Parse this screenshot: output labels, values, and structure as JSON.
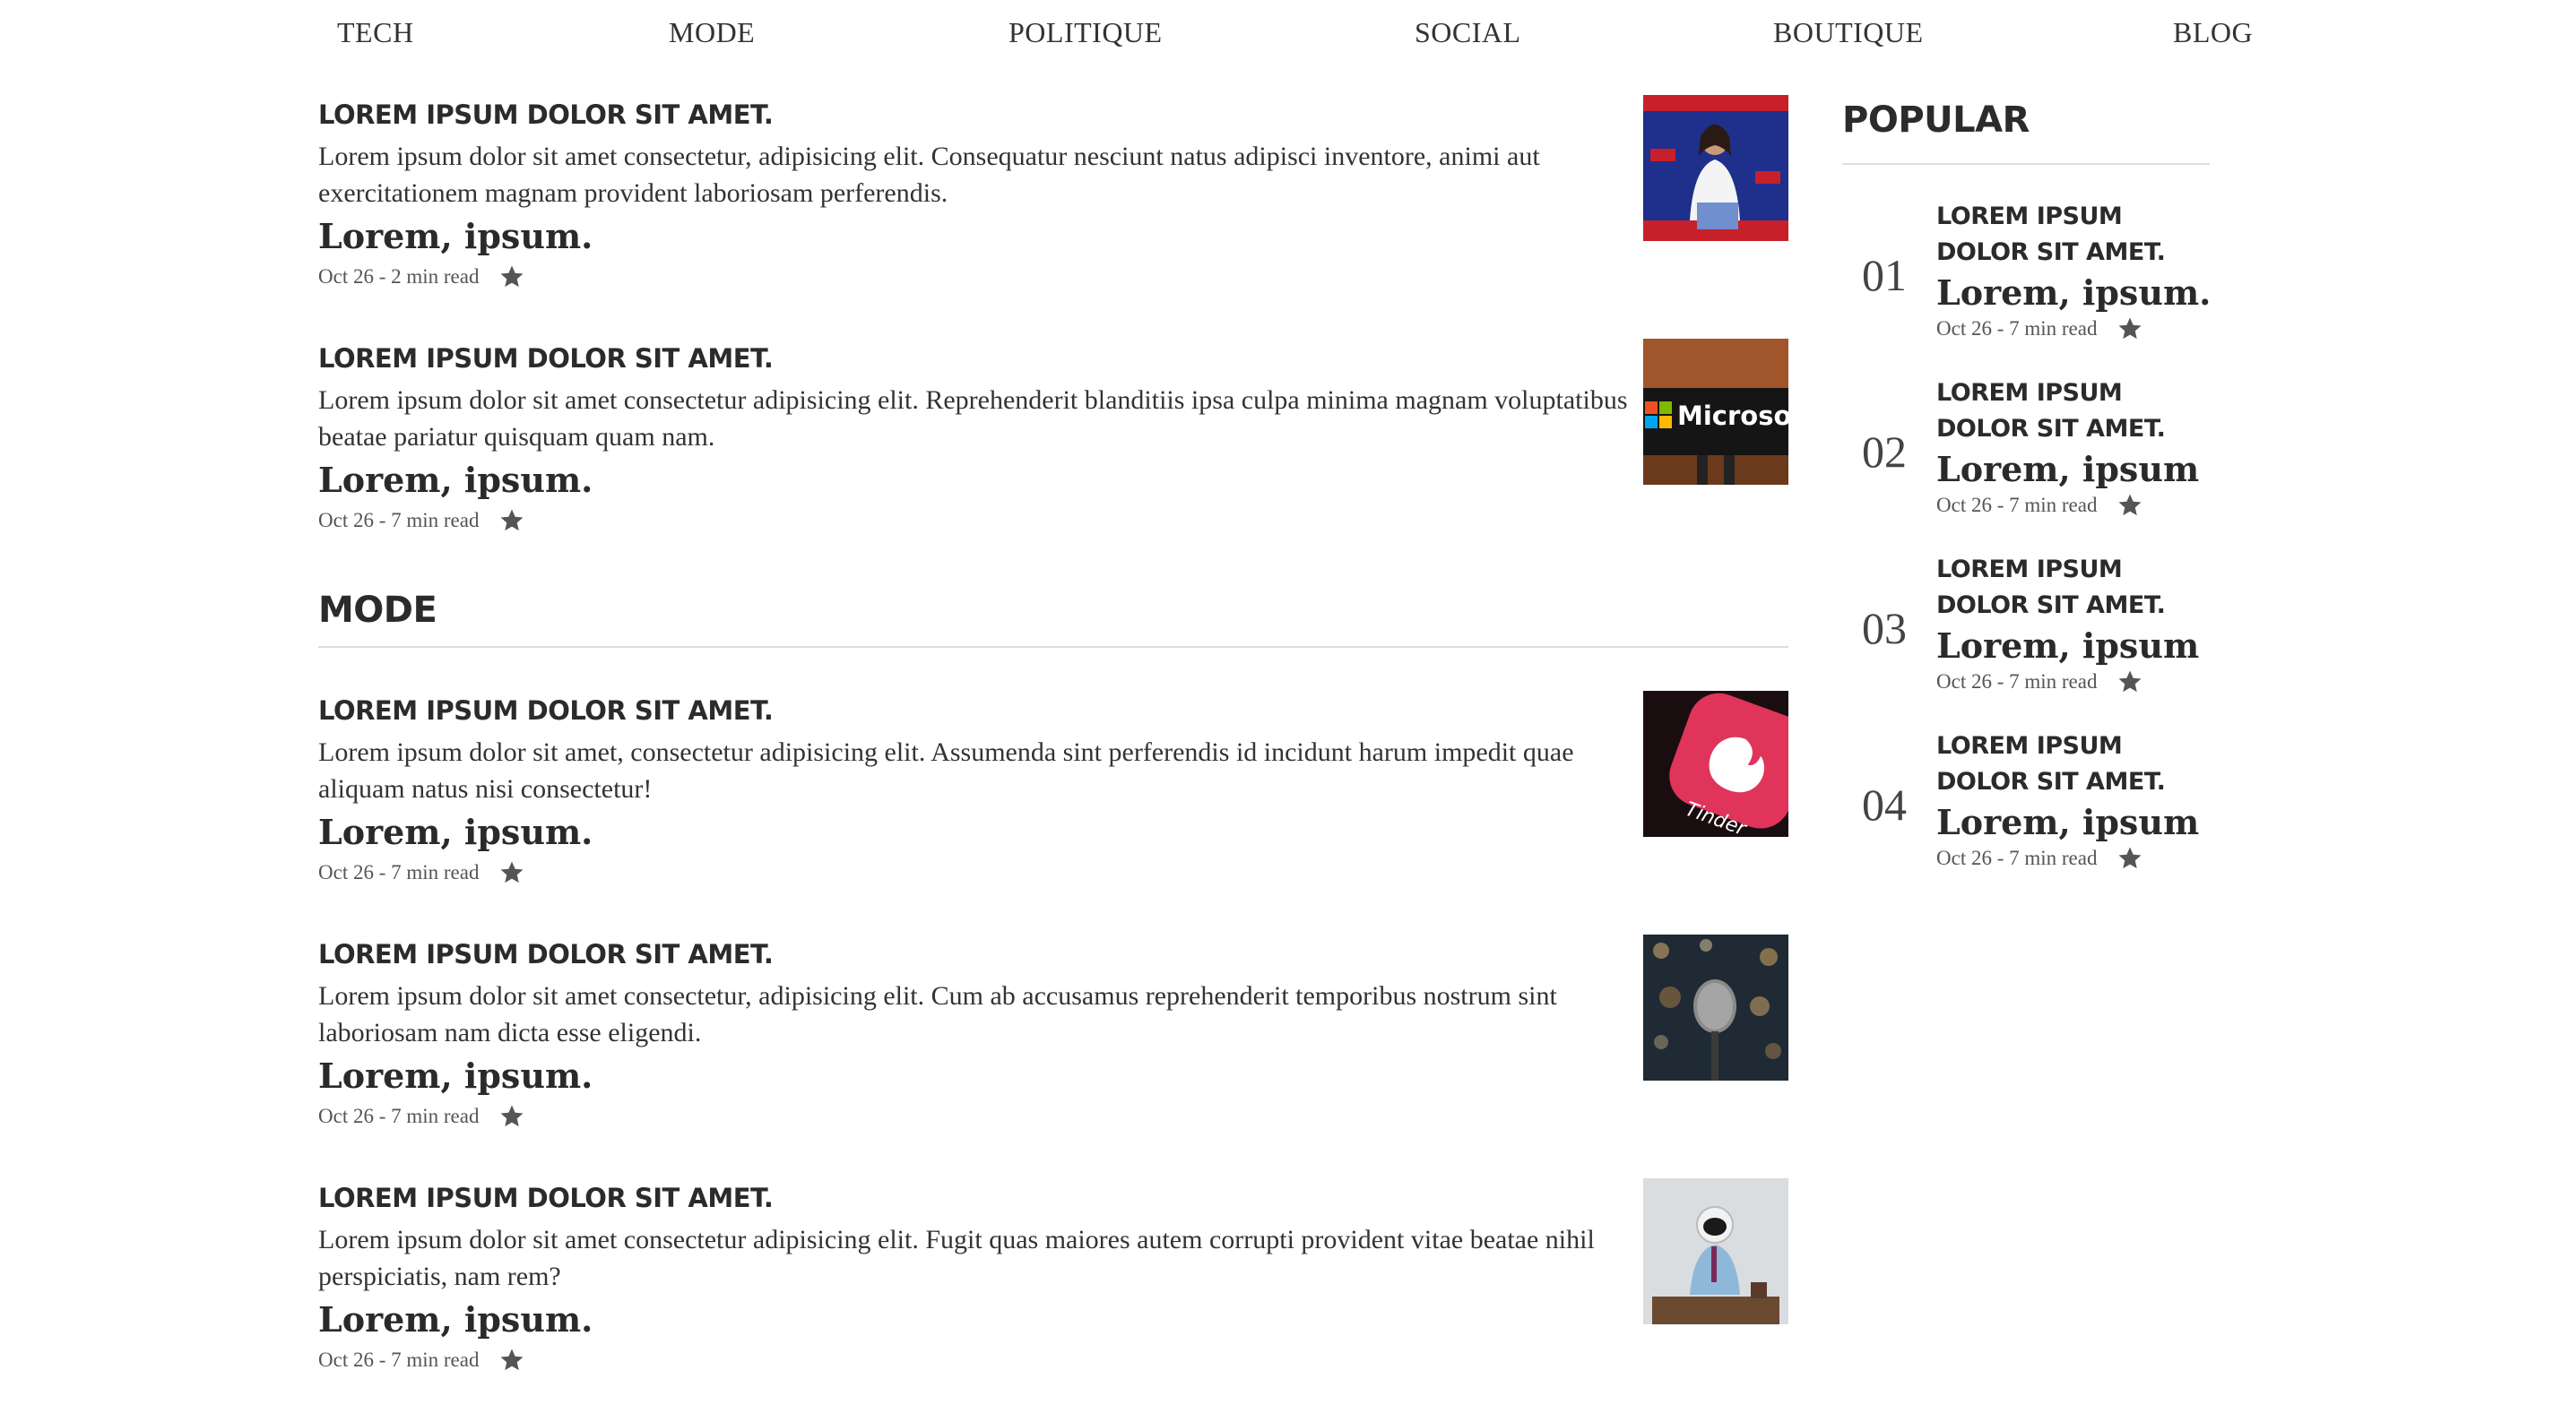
{
  "nav": [
    "TECH",
    "MODE",
    "POLITIQUE",
    "SOCIAL",
    "BOUTIQUE",
    "BLOG"
  ],
  "star_icon": "star-icon",
  "top_articles": [
    {
      "title": "LOREM IPSUM DOLOR SIT AMET.",
      "body": "Lorem ipsum dolor sit amet consectetur, adipisicing elit. Consequatur nesciunt natus adipisci inventore, animi aut exercitationem magnam provident laboriosam perferendis.",
      "subtitle": "Lorem, ipsum.",
      "meta": "Oct 26 - 2 min read",
      "thumb": "politician-at-podium"
    },
    {
      "title": "LOREM IPSUM DOLOR SIT AMET.",
      "body": "Lorem ipsum dolor sit amet consectetur adipisicing elit. Reprehenderit blanditiis ipsa culpa minima magnam voluptatibus beatae pariatur quisquam quam nam.",
      "subtitle": "Lorem, ipsum.",
      "meta": "Oct 26 - 7 min read",
      "thumb": "microsoft-sign",
      "thumb_text": "Microsoft"
    }
  ],
  "mode_section": {
    "heading": "MODE",
    "articles": [
      {
        "title": "LOREM IPSUM DOLOR SIT AMET.",
        "body": "Lorem ipsum dolor sit amet, consectetur adipisicing elit. Assumenda sint perferendis id incidunt harum impedit quae aliquam natus nisi consectetur!",
        "subtitle": "Lorem, ipsum.",
        "meta": "Oct 26 - 7 min read",
        "thumb": "tinder-app-icon",
        "thumb_text": "Tinder"
      },
      {
        "title": "LOREM IPSUM DOLOR SIT AMET.",
        "body": "Lorem ipsum dolor sit amet consectetur, adipisicing elit. Cum ab accusamus reprehenderit temporibus nostrum sint laboriosam nam dicta esse eligendi.",
        "subtitle": "Lorem, ipsum.",
        "meta": "Oct 26 - 7 min read",
        "thumb": "microphone-bokeh"
      },
      {
        "title": "LOREM IPSUM DOLOR SIT AMET.",
        "body": "Lorem ipsum dolor sit amet consectetur adipisicing elit. Fugit quas maiores autem corrupti provident vitae beatae nihil perspiciatis, nam rem?",
        "subtitle": "Lorem, ipsum.",
        "meta": "Oct 26 - 7 min read",
        "thumb": "astronaut-at-desk"
      }
    ]
  },
  "popular": {
    "heading": "POPULAR",
    "items": [
      {
        "num": "01",
        "title": "LOREM IPSUM DOLOR SIT AMET.",
        "subtitle": "Lorem, ipsum.",
        "meta": "Oct 26 - 7 min read"
      },
      {
        "num": "02",
        "title": "LOREM IPSUM DOLOR SIT AMET.",
        "subtitle": "Lorem, ipsum",
        "meta": "Oct 26 - 7 min read"
      },
      {
        "num": "03",
        "title": "LOREM IPSUM DOLOR SIT AMET.",
        "subtitle": "Lorem, ipsum",
        "meta": "Oct 26 - 7 min read"
      },
      {
        "num": "04",
        "title": "LOREM IPSUM DOLOR SIT AMET.",
        "subtitle": "Lorem, ipsum",
        "meta": "Oct 26 - 7 min read"
      }
    ]
  }
}
